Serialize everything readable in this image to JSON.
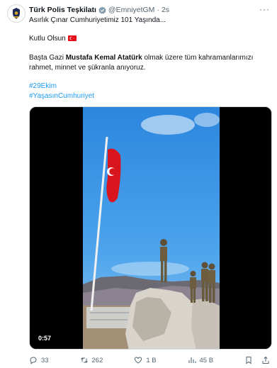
{
  "tweet": {
    "display_name": "Türk Polis Teşkilatı",
    "handle": "@EmniyetGM",
    "separator": "·",
    "time": "2s",
    "line1": "Asırlık Çınar Cumhuriyetimiz 101 Yaşında...",
    "line2": "Kutlu Olsun",
    "line3_a": "Başta Gazi ",
    "line3_bold": "Mustafa Kemal Atatürk",
    "line3_b": " olmak üzere tüm kahramanlarımızı",
    "line4": "rahmet, minnet ve şükranla anıyoruz.",
    "hashtag1": "#29Ekim",
    "hashtag2": "#YaşasınCumhuriyet"
  },
  "media": {
    "duration": "0:57"
  },
  "actions": {
    "replies": "33",
    "reposts": "262",
    "likes": "1 B",
    "views": "45 B"
  },
  "colors": {
    "accent": "#1d9bf0",
    "muted": "#536471",
    "flag_red": "#e30a17",
    "sky": "#2f8ee4"
  },
  "icons": [
    "police-badge-avatar",
    "verified-badge-icon",
    "more-icon",
    "turkey-flag-emoji",
    "reply-icon",
    "repost-icon",
    "like-icon",
    "views-icon",
    "bookmark-icon",
    "share-icon"
  ]
}
